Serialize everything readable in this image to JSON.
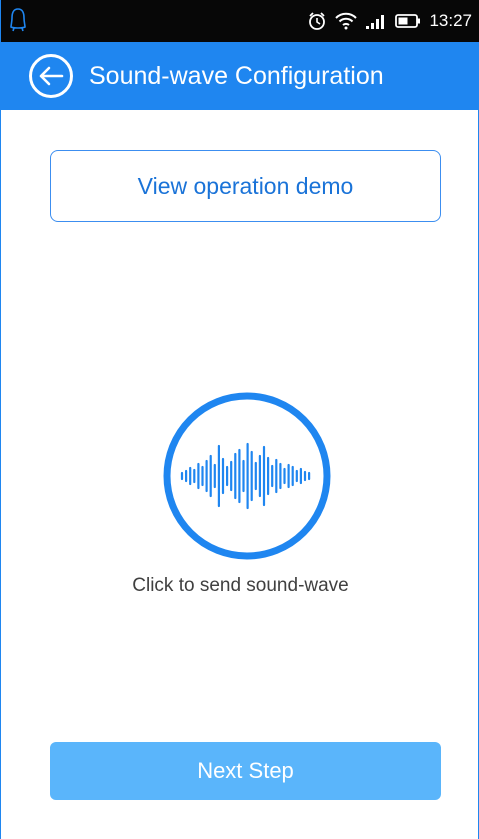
{
  "status_bar": {
    "time": "13:27",
    "left_icon": "qq-penguin-icon",
    "icons": [
      "alarm-icon",
      "wifi-icon",
      "signal-icon",
      "battery-icon"
    ]
  },
  "header": {
    "title": "Sound-wave Configuration",
    "back_icon": "back-arrow-icon",
    "background_color": "#1f86f0"
  },
  "demo_button": {
    "label": "View operation demo"
  },
  "sound_wave": {
    "icon": "sound-wave-icon",
    "caption": "Click to send sound-wave",
    "accent_color": "#1f86f0"
  },
  "next_button": {
    "label": "Next Step",
    "color": "#5ab5fb"
  }
}
